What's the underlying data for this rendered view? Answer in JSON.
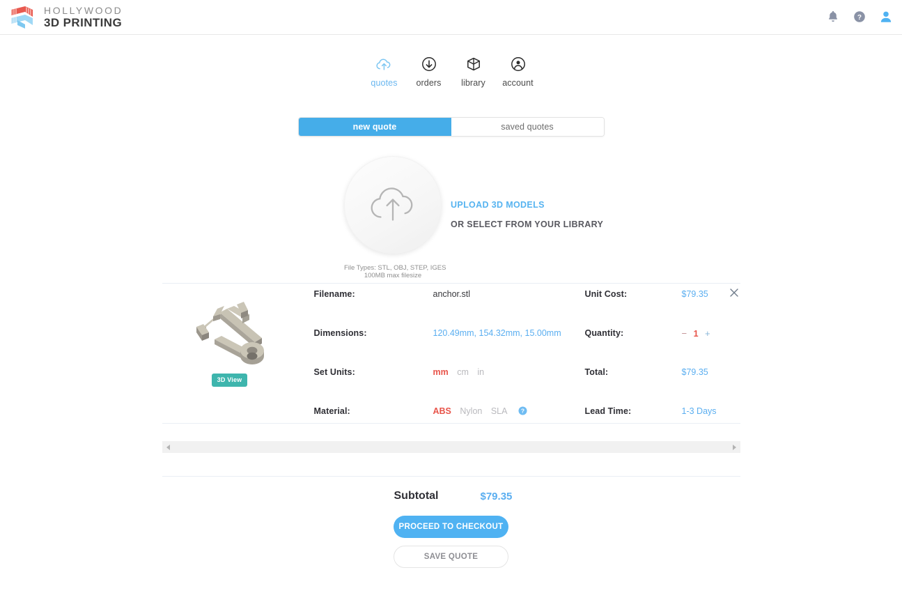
{
  "header": {
    "logo": {
      "line1": "HOLLYWOOD",
      "line2": "3D PRINTING",
      "icon_name": "hollywood-3d-printing-logo",
      "color_red": "#e8594f",
      "color_blue": "#9fd8f5"
    },
    "icons": [
      {
        "name": "notifications-bell-icon",
        "glyph": "bell"
      },
      {
        "name": "help-circle-icon",
        "glyph": "question"
      },
      {
        "name": "user-avatar-icon",
        "glyph": "person"
      }
    ]
  },
  "nav": {
    "items": [
      {
        "label": "quotes",
        "icon": "cloud-upload-icon",
        "active": true
      },
      {
        "label": "orders",
        "icon": "circle-down-arrow-icon",
        "active": false
      },
      {
        "label": "library",
        "icon": "cube-outline-icon",
        "active": false
      },
      {
        "label": "account",
        "icon": "circle-person-icon",
        "active": false
      }
    ]
  },
  "tabs": {
    "items": [
      {
        "label": "new quote",
        "active": true
      },
      {
        "label": "saved quotes",
        "active": false
      }
    ]
  },
  "upload": {
    "icon_name": "cloud-upload-large-icon",
    "primary_link": "UPLOAD 3D MODELS",
    "secondary_link": "OR SELECT FROM YOUR LIBRARY",
    "filetypes_line1": "File Types: STL, OBJ, STEP, IGES",
    "filetypes_line2": "100MB max filesize"
  },
  "quote_item": {
    "close_label": "×",
    "thumbnail_name": "anchor-3d-model-preview",
    "view_3d_badge": "3D View",
    "fields_left": [
      {
        "label": "Filename:",
        "value": "anchor.stl"
      },
      {
        "label": "Dimensions:",
        "value": "120.49mm, 154.32mm, 15.00mm"
      },
      {
        "label": "Set Units:",
        "value": ""
      },
      {
        "label": "Material:",
        "value": ""
      }
    ],
    "units": [
      {
        "label": "mm",
        "selected": true
      },
      {
        "label": "cm",
        "selected": false
      },
      {
        "label": "in",
        "selected": false
      }
    ],
    "materials": [
      {
        "label": "ABS",
        "selected": true
      },
      {
        "label": "Nylon",
        "selected": false
      },
      {
        "label": "SLA",
        "selected": false
      }
    ],
    "material_help_icon": "material-help-icon",
    "fields_right": [
      {
        "label": "Unit Cost:",
        "value": "$79.35"
      },
      {
        "label": "Quantity:",
        "value": ""
      },
      {
        "label": "Total:",
        "value": "$79.35"
      },
      {
        "label": "Lead Time:",
        "value": "1-3 Days"
      }
    ],
    "quantity": {
      "minus": "−",
      "value": "1",
      "plus": "+"
    }
  },
  "totals": {
    "subtotal_label": "Subtotal",
    "subtotal_value": "$79.35",
    "checkout_button": "PROCEED TO CHECKOUT",
    "save_button": "SAVE QUOTE"
  },
  "colors": {
    "accent_blue": "#4fb2f2",
    "link_blue": "#5aaef0",
    "select_red": "#e8544a",
    "teal_badge": "#3eb5ad"
  }
}
